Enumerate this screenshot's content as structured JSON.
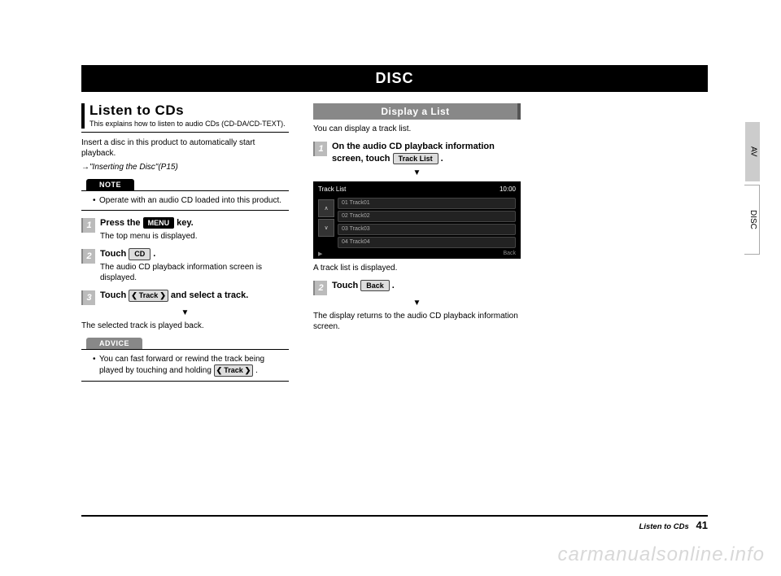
{
  "chapter": "DISC",
  "side_tabs": {
    "av": "AV",
    "disc": "DISC"
  },
  "left": {
    "title": "Listen to CDs",
    "subtitle": "This explains how to listen to audio CDs (CD-DA/CD-TEXT).",
    "intro": "Insert a disc in this product to automatically start playback.",
    "intro_ref": "→\"Inserting the Disc\"(P15)",
    "note_label": "NOTE",
    "note_text": "Operate with an audio CD loaded into this product.",
    "step1_a": "Press the ",
    "step1_key": "MENU",
    "step1_b": " key.",
    "step1_sub": "The top menu is displayed.",
    "step2_a": "Touch ",
    "step2_key": "CD",
    "step2_b": " .",
    "step2_sub": "The audio CD playback information screen is displayed.",
    "step3_a": "Touch ",
    "step3_track": "Track",
    "step3_b": " and select a track.",
    "result": "The selected track is played back.",
    "advice_label": "ADVICE",
    "advice_text_a": "You can fast forward or rewind the track being played by touching and holding ",
    "advice_track": "Track",
    "advice_text_b": " ."
  },
  "right": {
    "subheading": "Display a List",
    "intro": "You can display a track list.",
    "step1_a": "On the audio CD playback information screen, touch ",
    "step1_key": "Track List",
    "step1_b": " .",
    "screenshot": {
      "title": "Track List",
      "time": "10:00",
      "rows": [
        "01  Track01",
        "02  Track02",
        "03  Track03",
        "04  Track04"
      ],
      "back": "Back",
      "play": "▶"
    },
    "after_img": "A track list is displayed.",
    "step2_a": "Touch ",
    "step2_key": "Back",
    "step2_b": " .",
    "result": "The display returns to the audio CD playback information screen."
  },
  "footer": {
    "label": "Listen to CDs",
    "page": "41"
  },
  "watermark": "carmanualsonline.info"
}
